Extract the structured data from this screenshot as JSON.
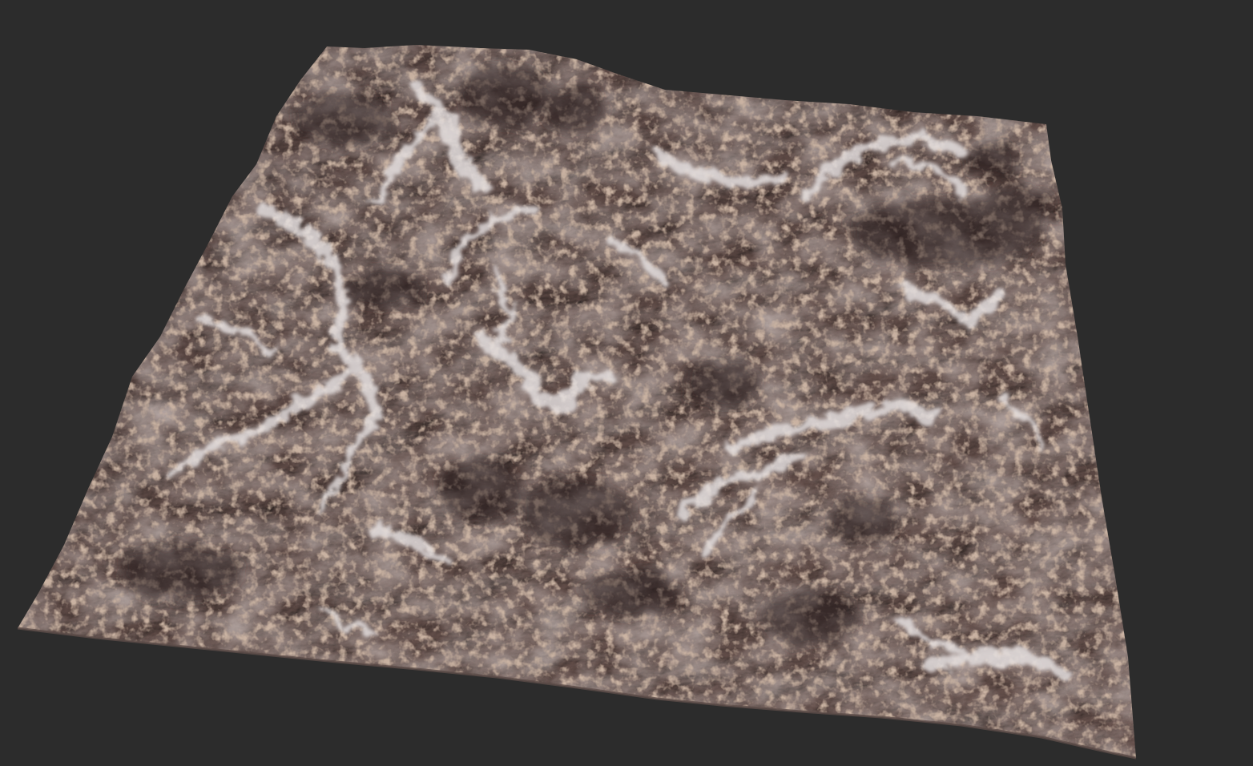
{
  "scene": {
    "background_color": "#2c2c2c",
    "subject": "terrain-heightmap-mesh",
    "palette": {
      "rock_base": "#7a6662",
      "rock_warm": "#8e7468",
      "rock_dark": "#3a2f2d",
      "sediment_light": "#d8d2d2",
      "orange_speckle": "#b88a6a"
    }
  }
}
